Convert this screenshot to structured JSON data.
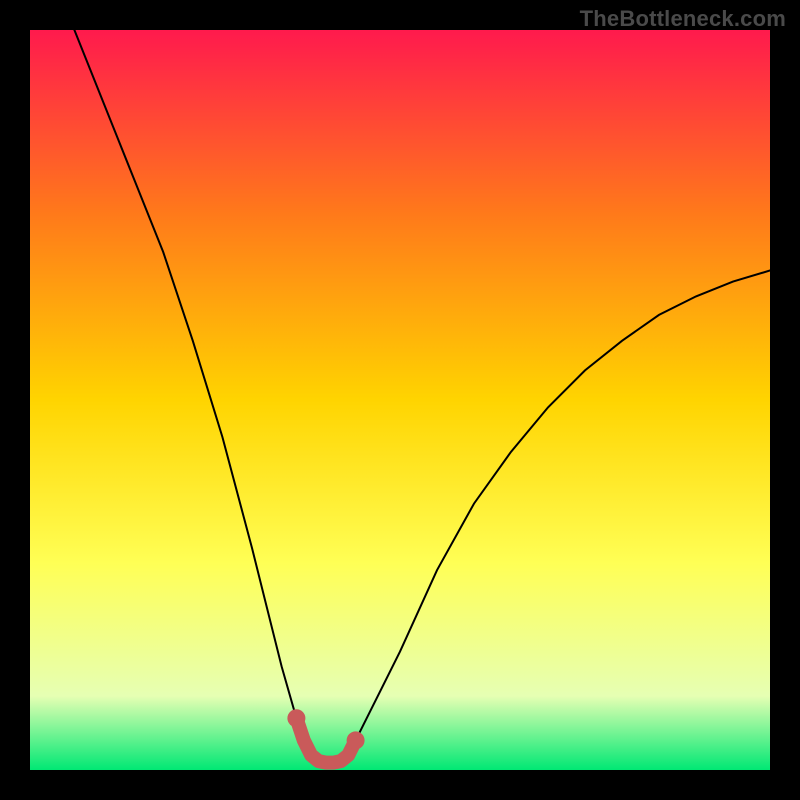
{
  "watermark": "TheBottleneck.com",
  "colors": {
    "frame": "#000000",
    "watermark": "#4a4a4a",
    "gradient_top": "#ff1a4d",
    "gradient_mid_upper": "#ff7a1a",
    "gradient_mid": "#ffd400",
    "gradient_mid_lower": "#ffff55",
    "gradient_lower": "#e6ffb3",
    "gradient_bottom": "#00e874",
    "curve": "#000000",
    "marker_stroke": "#c95a5a",
    "marker_fill": "#c95a5a"
  },
  "chart_data": {
    "type": "line",
    "title": "",
    "xlabel": "",
    "ylabel": "",
    "xlim": [
      0,
      100
    ],
    "ylim": [
      0,
      100
    ],
    "grid": false,
    "legend": false,
    "series": [
      {
        "name": "bottleneck-curve",
        "x": [
          6,
          10,
          14,
          18,
          22,
          26,
          30,
          32,
          34,
          36,
          37,
          38,
          39,
          40,
          41,
          42,
          43,
          44,
          46,
          50,
          55,
          60,
          65,
          70,
          75,
          80,
          85,
          90,
          95,
          100
        ],
        "y": [
          100,
          90,
          80,
          70,
          58,
          45,
          30,
          22,
          14,
          7,
          4,
          2,
          1.2,
          1,
          1,
          1.2,
          2,
          4,
          8,
          16,
          27,
          36,
          43,
          49,
          54,
          58,
          61.5,
          64,
          66,
          67.5
        ]
      }
    ],
    "highlight_segment": {
      "name": "flat-bottom-marker",
      "x": [
        36,
        37,
        38,
        39,
        40,
        41,
        42,
        43,
        44
      ],
      "y": [
        7,
        4,
        2,
        1.2,
        1,
        1,
        1.2,
        2,
        4
      ]
    }
  }
}
